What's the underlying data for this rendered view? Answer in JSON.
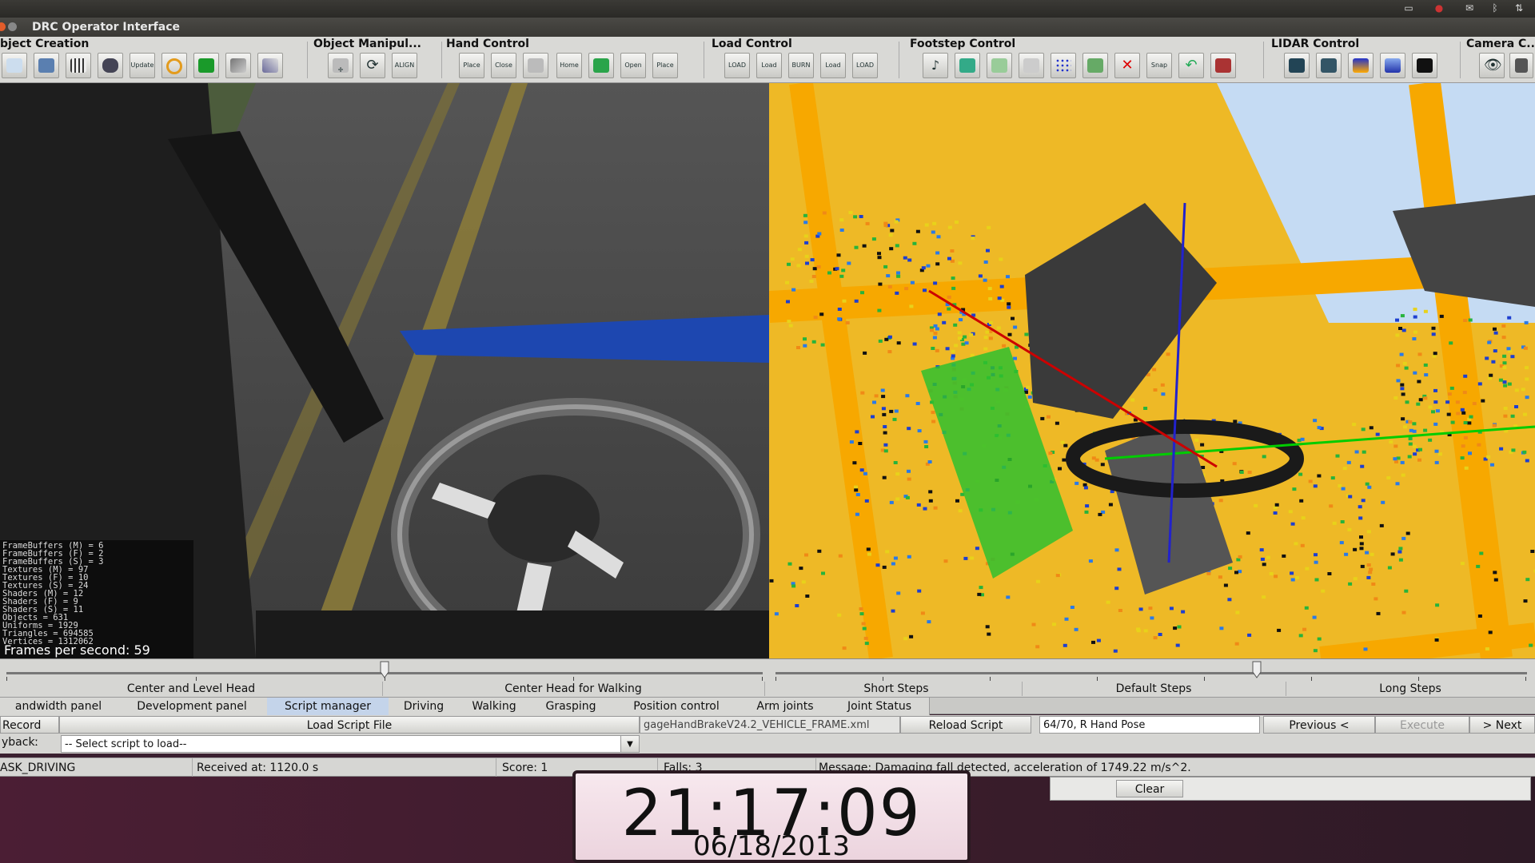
{
  "window": {
    "title": "DRC Operator Interface"
  },
  "toolbar": {
    "groups": [
      {
        "title": "bject Creation",
        "buttons": [
          "",
          "",
          "",
          "",
          "Update",
          "",
          "",
          "",
          ""
        ]
      },
      {
        "title": "Object Manipul...",
        "buttons": [
          "",
          "",
          "ALIGN"
        ]
      },
      {
        "title": "Hand Control",
        "buttons": [
          "Place",
          "Close",
          "",
          "Home",
          "",
          "Open",
          "Place"
        ]
      },
      {
        "title": "Load Control",
        "buttons": [
          "LOAD",
          "Load",
          "BURN LOAD",
          "Load",
          "LOAD"
        ]
      },
      {
        "title": "Footstep Control",
        "buttons": [
          "",
          "",
          "",
          "",
          "",
          "",
          "",
          "Snap",
          "",
          ""
        ]
      },
      {
        "title": "LIDAR Control",
        "buttons": [
          "",
          "",
          "",
          "",
          ""
        ]
      },
      {
        "title": "Camera C...",
        "buttons": [
          "",
          ""
        ]
      }
    ]
  },
  "left_view": {
    "stats": [
      "FrameBuffers (M) = 6",
      "FrameBuffers (F) = 2",
      "FrameBuffers (S) = 3",
      "Textures (M) = 97",
      "Textures (F) = 10",
      "Textures (S) = 24",
      "Shaders (M) = 12",
      "Shaders (F) = 9",
      "Shaders (S) = 11",
      "Objects = 631",
      "Uniforms = 1929",
      "Triangles = 694585",
      "Vertices = 1312062"
    ],
    "fps": "Frames per second: 59",
    "head_slider_value": 0.5
  },
  "right_view": {
    "step_slider_value": 0.64
  },
  "slider_labels": {
    "head_left": "Center and Level Head",
    "head_right": "Center Head for Walking",
    "steps_short": "Short Steps",
    "steps_default": "Default Steps",
    "steps_long": "Long Steps"
  },
  "tabs": [
    {
      "label": "andwidth panel",
      "active": false
    },
    {
      "label": "Development panel",
      "active": false
    },
    {
      "label": "Script manager",
      "active": true
    },
    {
      "label": "Driving",
      "active": false
    },
    {
      "label": "Walking",
      "active": false
    },
    {
      "label": "Grasping",
      "active": false
    },
    {
      "label": "Position control",
      "active": false
    },
    {
      "label": "Arm joints",
      "active": false
    },
    {
      "label": "Joint Status",
      "active": false
    }
  ],
  "script_manager": {
    "record_label": "Record",
    "load_script_label": "Load Script File",
    "script_file": "gageHandBrakeV24.2_VEHICLE_FRAME.xml",
    "reload_label": "Reload Script",
    "progress_text": "64/70, R Hand Pose",
    "previous_label": "Previous <",
    "execute_label": "Execute",
    "next_label": "> Next",
    "playback_label": "ybackː",
    "select_placeholder": "-- Select script to load--"
  },
  "status": {
    "task": "ASK_DRIVING",
    "received": "Received at:  1120.0 s",
    "score": "Score:  1",
    "falls": "Falls:  3",
    "message": "Message:  Damaging fall detected, acceleration of 1749.22 m/s^2."
  },
  "clear_label": "Clear",
  "clock": {
    "time": "21:17:09",
    "date": "06/18/2013"
  }
}
